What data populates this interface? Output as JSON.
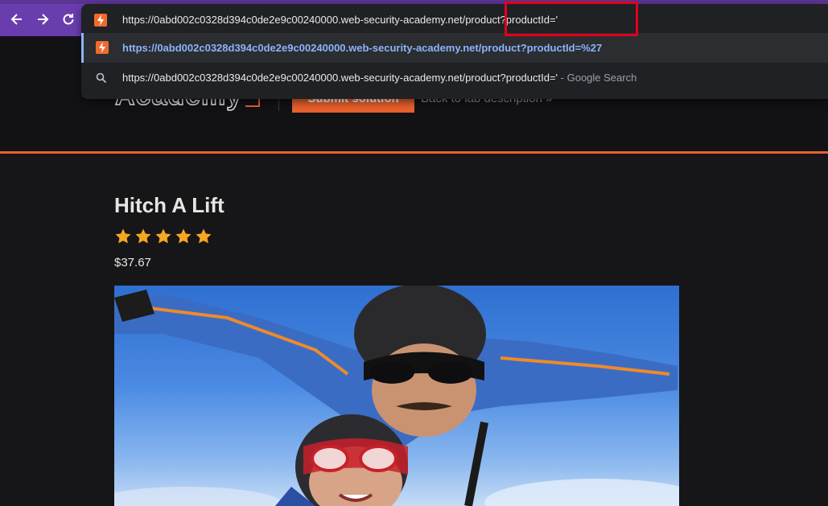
{
  "browser": {
    "nav": {
      "back_icon": "arrow-left-icon",
      "forward_icon": "arrow-right-icon",
      "reload_icon": "reload-icon"
    },
    "omnibox": {
      "input_prefix": "https://0abd002c0328d394c0de2e9c00240000.web-security-academy.net",
      "input_suffix": "/product?productId='",
      "suggestions": [
        {
          "type": "url",
          "text": "https://0abd002c0328d394c0de2e9c00240000.web-security-academy.net/product?productId=%27",
          "icon": "burp-favicon-icon"
        },
        {
          "type": "search",
          "text": "https://0abd002c0328d394c0de2e9c00240000.web-security-academy.net/product?productId='",
          "suffix": " - Google Search",
          "icon": "search-icon"
        }
      ]
    },
    "colors": {
      "toolbar": "#6a3dae",
      "highlight": "#e3001b",
      "link": "#8ab4f8"
    }
  },
  "site": {
    "logo_text": "Academy",
    "submit_label": "Submit solution",
    "back_link": "Back to lab description",
    "accent": "#e8602c"
  },
  "product": {
    "title": "Hitch A Lift",
    "rating": 5,
    "rating_max": 5,
    "price": "$37.67",
    "star_color": "#f5a623"
  }
}
